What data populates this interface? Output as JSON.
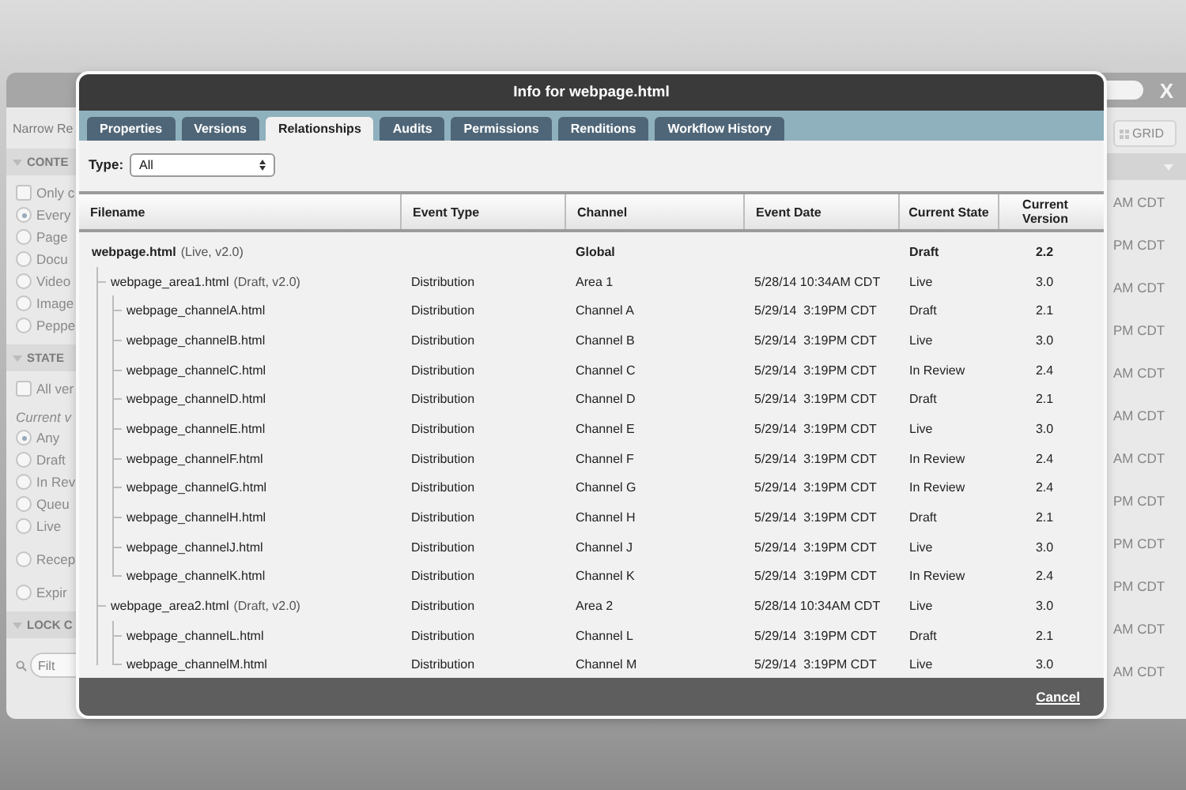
{
  "backdrop": {
    "toolbar": {
      "grid_button": "GRID",
      "close": "X"
    },
    "sidebar": {
      "heading": "Narrow Re",
      "sections": [
        {
          "title": "CONTE",
          "expanded": true,
          "items": [
            {
              "kind": "checkbox",
              "label": "Only c",
              "checked": false
            },
            {
              "kind": "radio",
              "label": "Every",
              "selected": true
            },
            {
              "kind": "radio",
              "label": "Page",
              "selected": false
            },
            {
              "kind": "radio",
              "label": "Docu",
              "selected": false
            },
            {
              "kind": "radio",
              "label": "Video",
              "selected": false
            },
            {
              "kind": "radio",
              "label": "Image",
              "selected": false
            },
            {
              "kind": "radio",
              "label": "Peppe",
              "selected": false
            }
          ]
        },
        {
          "title": "STATE",
          "expanded": true,
          "items": [
            {
              "kind": "checkbox",
              "label": "All ver",
              "checked": false
            },
            {
              "kind": "caption",
              "label": "Current v"
            },
            {
              "kind": "radio",
              "label": "Any",
              "selected": true
            },
            {
              "kind": "radio",
              "label": "Draft",
              "selected": false
            },
            {
              "kind": "radio",
              "label": "In Rev",
              "selected": false
            },
            {
              "kind": "radio",
              "label": "Queu",
              "selected": false
            },
            {
              "kind": "radio",
              "label": "Live",
              "selected": false
            },
            {
              "kind": "radio",
              "label": "Recep",
              "selected": false
            },
            {
              "kind": "radio",
              "label": "Expir",
              "selected": false
            }
          ]
        },
        {
          "title": "LOCK C",
          "expanded": true,
          "items": [
            {
              "kind": "search",
              "placeholder": "Filt"
            }
          ]
        }
      ]
    },
    "times": [
      "AM CDT",
      "PM CDT",
      "AM CDT",
      "PM CDT",
      "AM CDT",
      "AM CDT",
      "AM CDT",
      "PM CDT",
      "PM CDT",
      "PM CDT",
      "AM CDT",
      "AM CDT"
    ]
  },
  "dialog": {
    "title": "Info for webpage.html",
    "tabs": [
      {
        "label": "Properties",
        "selected": false
      },
      {
        "label": "Versions",
        "selected": false
      },
      {
        "label": "Relationships",
        "selected": true
      },
      {
        "label": "Audits",
        "selected": false
      },
      {
        "label": "Permissions",
        "selected": false
      },
      {
        "label": "Renditions",
        "selected": false
      },
      {
        "label": "Workflow History",
        "selected": false
      }
    ],
    "type_filter": {
      "label": "Type:",
      "value": "All"
    },
    "table": {
      "columns": [
        "Filename",
        "Event Type",
        "Channel",
        "Event Date",
        "Current State",
        "Current Version"
      ],
      "rows": [
        {
          "filename": "webpage.html",
          "note": "(Live, v2.0)",
          "event_type": "",
          "channel": "Global",
          "event_date": "",
          "state": "Draft",
          "version": "2.2",
          "children": [
            {
              "filename": "webpage_area1.html",
              "note": "(Draft, v2.0)",
              "event_type": "Distribution",
              "channel": "Area 1",
              "event_date": "5/28/14 10:34AM CDT",
              "state": "Live",
              "version": "3.0",
              "children": [
                {
                  "filename": "webpage_channelA.html",
                  "event_type": "Distribution",
                  "channel": "Channel A",
                  "event_date": "5/29/14  3:19PM CDT",
                  "state": "Draft",
                  "version": "2.1"
                },
                {
                  "filename": "webpage_channelB.html",
                  "event_type": "Distribution",
                  "channel": "Channel B",
                  "event_date": "5/29/14  3:19PM CDT",
                  "state": "Live",
                  "version": "3.0"
                },
                {
                  "filename": "webpage_channelC.html",
                  "event_type": "Distribution",
                  "channel": "Channel C",
                  "event_date": "5/29/14  3:19PM CDT",
                  "state": "In Review",
                  "version": "2.4"
                },
                {
                  "filename": "webpage_channelD.html",
                  "event_type": "Distribution",
                  "channel": "Channel D",
                  "event_date": "5/29/14  3:19PM CDT",
                  "state": "Draft",
                  "version": "2.1"
                },
                {
                  "filename": "webpage_channelE.html",
                  "event_type": "Distribution",
                  "channel": "Channel E",
                  "event_date": "5/29/14  3:19PM CDT",
                  "state": "Live",
                  "version": "3.0"
                },
                {
                  "filename": "webpage_channelF.html",
                  "event_type": "Distribution",
                  "channel": "Channel F",
                  "event_date": "5/29/14  3:19PM CDT",
                  "state": "In Review",
                  "version": "2.4"
                },
                {
                  "filename": "webpage_channelG.html",
                  "event_type": "Distribution",
                  "channel": "Channel G",
                  "event_date": "5/29/14  3:19PM CDT",
                  "state": "In Review",
                  "version": "2.4"
                },
                {
                  "filename": "webpage_channelH.html",
                  "event_type": "Distribution",
                  "channel": "Channel H",
                  "event_date": "5/29/14  3:19PM CDT",
                  "state": "Draft",
                  "version": "2.1"
                },
                {
                  "filename": "webpage_channelJ.html",
                  "event_type": "Distribution",
                  "channel": "Channel J",
                  "event_date": "5/29/14  3:19PM CDT",
                  "state": "Live",
                  "version": "3.0"
                },
                {
                  "filename": "webpage_channelK.html",
                  "event_type": "Distribution",
                  "channel": "Channel K",
                  "event_date": "5/29/14  3:19PM CDT",
                  "state": "In Review",
                  "version": "2.4"
                }
              ]
            },
            {
              "filename": "webpage_area2.html",
              "note": "(Draft, v2.0)",
              "event_type": "Distribution",
              "channel": "Area 2",
              "event_date": "5/28/14 10:34AM CDT",
              "state": "Live",
              "version": "3.0",
              "children": [
                {
                  "filename": "webpage_channelL.html",
                  "event_type": "Distribution",
                  "channel": "Channel L",
                  "event_date": "5/29/14  3:19PM CDT",
                  "state": "Draft",
                  "version": "2.1"
                },
                {
                  "filename": "webpage_channelM.html",
                  "event_type": "Distribution",
                  "channel": "Channel M",
                  "event_date": "5/29/14  3:19PM CDT",
                  "state": "Live",
                  "version": "3.0"
                }
              ]
            }
          ]
        }
      ]
    },
    "footer": {
      "cancel": "Cancel"
    }
  }
}
